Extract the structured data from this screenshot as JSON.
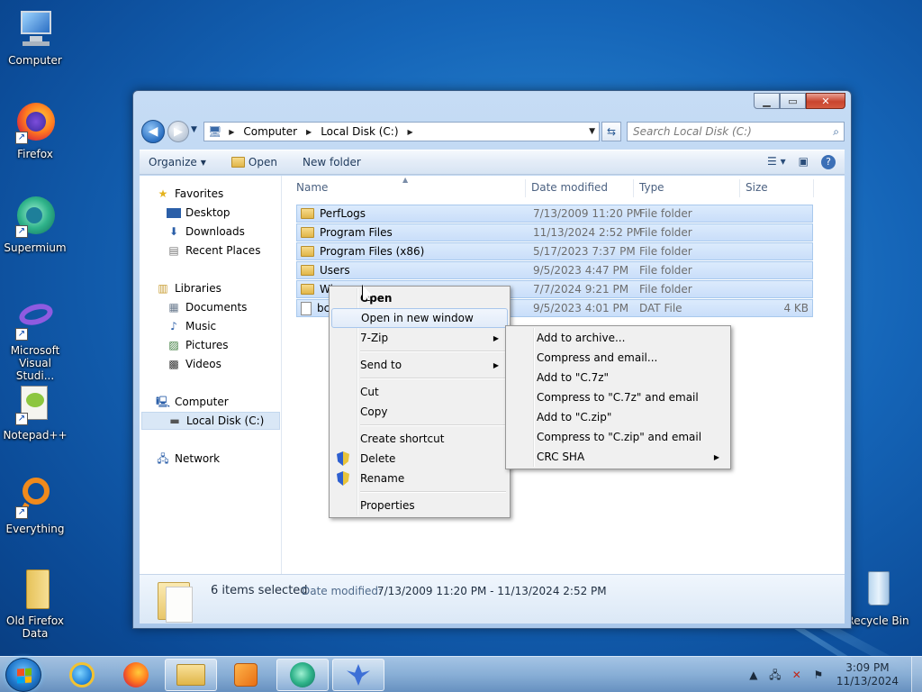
{
  "desktop": {
    "icons": [
      {
        "label": "Computer",
        "icon": "computer-icon"
      },
      {
        "label": "Firefox",
        "icon": "firefox-icon"
      },
      {
        "label": "Supermium",
        "icon": "supermium-icon"
      },
      {
        "label": "Microsoft Visual Studi...",
        "icon": "visual-studio-icon"
      },
      {
        "label": "Notepad++",
        "icon": "notepadpp-icon"
      },
      {
        "label": "Everything",
        "icon": "everything-icon"
      },
      {
        "label": "Old Firefox Data",
        "icon": "folder-icon"
      },
      {
        "label": "Recycle Bin",
        "icon": "recycle-bin-icon"
      }
    ]
  },
  "window": {
    "address": {
      "crumbs": [
        "Computer",
        "Local Disk (C:)"
      ]
    },
    "search_placeholder": "Search Local Disk (C:)",
    "toolbar": {
      "organize": "Organize",
      "open": "Open",
      "new_folder": "New folder"
    },
    "nav": {
      "favorites": "Favorites",
      "desktop": "Desktop",
      "downloads": "Downloads",
      "recent_places": "Recent Places",
      "libraries": "Libraries",
      "documents": "Documents",
      "music": "Music",
      "pictures": "Pictures",
      "videos": "Videos",
      "computer": "Computer",
      "local_disk": "Local Disk (C:)",
      "network": "Network"
    },
    "columns": {
      "name": "Name",
      "date": "Date modified",
      "type": "Type",
      "size": "Size"
    },
    "files": [
      {
        "name": "PerfLogs",
        "date": "7/13/2009 11:20 PM",
        "type": "File folder",
        "size": ""
      },
      {
        "name": "Program Files",
        "date": "11/13/2024 2:52 PM",
        "type": "File folder",
        "size": ""
      },
      {
        "name": "Program Files (x86)",
        "date": "5/17/2023 7:37 PM",
        "type": "File folder",
        "size": ""
      },
      {
        "name": "Users",
        "date": "9/5/2023 4:47 PM",
        "type": "File folder",
        "size": ""
      },
      {
        "name": "Wi",
        "date": "7/7/2024 9:21 PM",
        "type": "File folder",
        "size": ""
      },
      {
        "name": "bc",
        "date": "9/5/2023 4:01 PM",
        "type": "DAT File",
        "size": "4 KB"
      }
    ],
    "details": {
      "selected": "6 items selected",
      "date_label": "Date modified:",
      "date_value": "7/13/2009 11:20 PM - 11/13/2024 2:52 PM"
    }
  },
  "context_menu": {
    "open": "Open",
    "open_new_window": "Open in new window",
    "seven_zip": "7-Zip",
    "send_to": "Send to",
    "cut": "Cut",
    "copy": "Copy",
    "create_shortcut": "Create shortcut",
    "delete": "Delete",
    "rename": "Rename",
    "properties": "Properties"
  },
  "submenu_7zip": {
    "add_archive": "Add to archive...",
    "compress_email": "Compress and email...",
    "add_7z": "Add to \"C.7z\"",
    "compress_7z_email": "Compress to \"C.7z\" and email",
    "add_zip": "Add to \"C.zip\"",
    "compress_zip_email": "Compress to \"C.zip\" and email",
    "crc_sha": "CRC SHA"
  },
  "taskbar": {
    "time": "3:09 PM",
    "date": "11/13/2024"
  }
}
